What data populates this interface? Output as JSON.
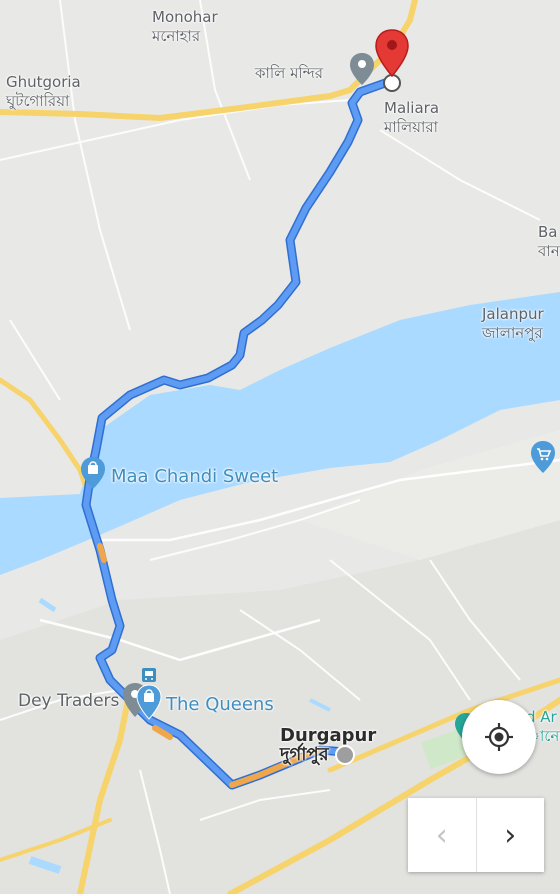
{
  "map": {
    "places": {
      "monohar": {
        "en": "Monohar",
        "bn": "মনোহার"
      },
      "ghutgoria": {
        "en": "Ghutgoria",
        "bn": "ঘুটগোরিয়া"
      },
      "kali_mandir": {
        "bn": "কালি মন্দির"
      },
      "maliara": {
        "en": "Maliara",
        "bn": "মালিয়ারা"
      },
      "ba": {
        "en": "Ba",
        "bn": "বান"
      },
      "jalanpur": {
        "en": "Jalanpur",
        "bn": "জালানপুর"
      },
      "maa_chandi_sweet": {
        "en": "Maa Chandi Sweet"
      },
      "dey_traders": {
        "en": "Dey Traders"
      },
      "the_queens": {
        "en": "The Queens"
      },
      "durgapur": {
        "en": "Durgapur",
        "bn": "দুর্গাপুর"
      },
      "partial_right": {
        "en": "d Ar",
        "bn": "ানো"
      }
    },
    "icons": {
      "destination": "red-location-pin-icon",
      "place": "gray-place-pin-icon",
      "shopping": "shopping-bag-icon",
      "cart": "shopping-cart-icon",
      "bus": "bus-stop-icon"
    },
    "controls": {
      "my_location": "crosshair-gps-icon",
      "prev_label": "‹",
      "next_label": "›"
    },
    "colors": {
      "water": "#aadaff",
      "route": "#4a86e8",
      "route_traffic": "#f0a64b",
      "road_major": "#f7d36b",
      "destination": "#e53935",
      "land": "#e8e8e6"
    }
  }
}
